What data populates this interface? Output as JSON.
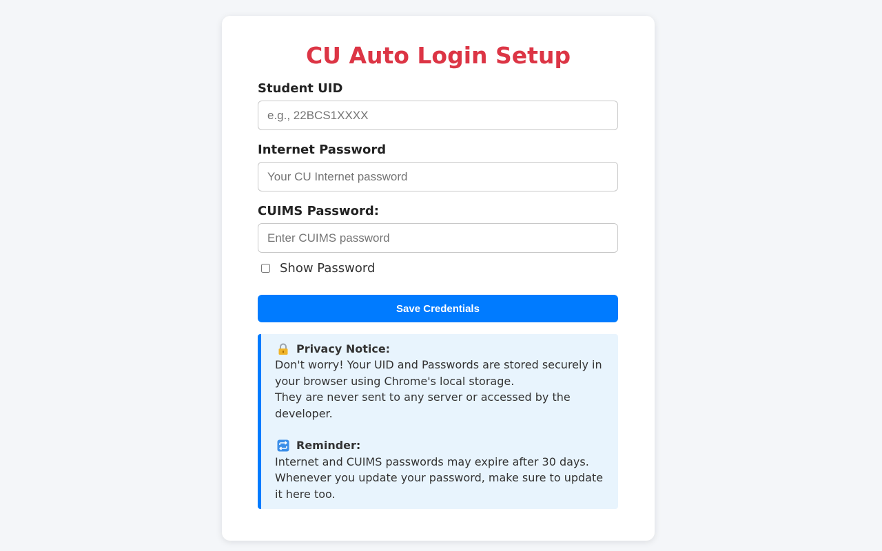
{
  "form": {
    "title": "CU Auto Login Setup",
    "uid_label": "Student UID",
    "uid_placeholder": "e.g., 22BCS1XXXX",
    "uid_value": "",
    "internet_label": "Internet Password",
    "internet_placeholder": "Your CU Internet password",
    "internet_value": "",
    "cuims_label": "CUIMS Password:",
    "cuims_placeholder": "Enter CUIMS password",
    "cuims_value": "",
    "show_password_label": "Show Password",
    "show_password_checked": false,
    "save_button": "Save Credentials"
  },
  "notice": {
    "privacy_icon": "lock-icon",
    "privacy_title": "Privacy Notice:",
    "privacy_line1": "Don't worry! Your UID and Passwords are stored securely in your browser using Chrome's local storage.",
    "privacy_line2": "They are never sent to any server or accessed by the developer.",
    "reminder_icon": "repeat-icon",
    "reminder_title": "Reminder:",
    "reminder_line1": "Internet and CUIMS passwords may expire after 30 days.",
    "reminder_line2": "Whenever you update your password, make sure to update it here too."
  },
  "colors": {
    "title": "#dc3545",
    "button": "#007bff",
    "notice_bg": "#e8f4fd",
    "notice_border": "#007bff",
    "page_bg": "#f4f6f9"
  }
}
